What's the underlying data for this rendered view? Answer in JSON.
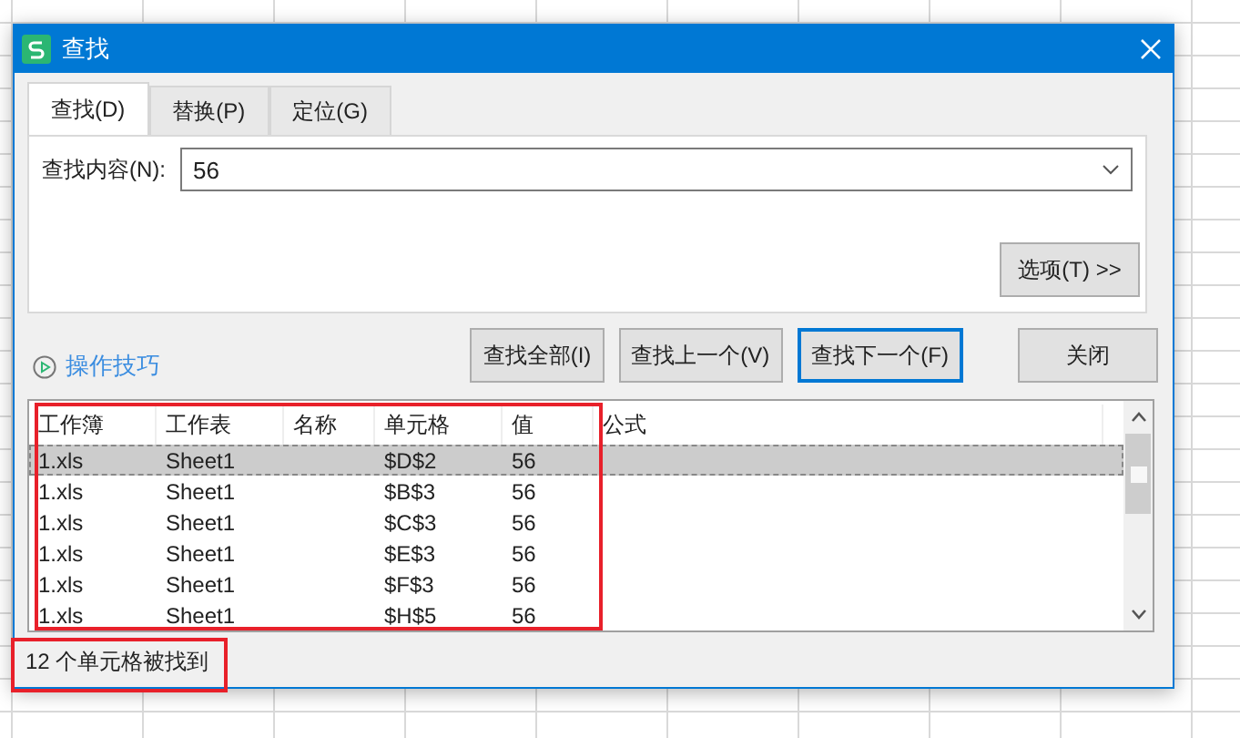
{
  "window": {
    "title": "查找"
  },
  "tabs": [
    {
      "label": "查找(D)",
      "selected": true
    },
    {
      "label": "替换(P)",
      "selected": false
    },
    {
      "label": "定位(G)",
      "selected": false
    }
  ],
  "find_field": {
    "label": "查找内容(N):",
    "value": "56"
  },
  "options_button": "选项(T) >>",
  "tips_link": "操作技巧",
  "buttons": [
    {
      "label": "查找全部(I)",
      "default": false
    },
    {
      "label": "查找上一个(V)",
      "default": false
    },
    {
      "label": "查找下一个(F)",
      "default": true
    }
  ],
  "close_button": "关闭",
  "results": {
    "highlighted": true,
    "columns": [
      "工作簿",
      "工作表",
      "名称",
      "单元格",
      "值",
      "公式"
    ],
    "rows": [
      {
        "workbook": "1.xls",
        "sheet": "Sheet1",
        "cell": "$D$2",
        "value": "56",
        "selected": true
      },
      {
        "workbook": "1.xls",
        "sheet": "Sheet1",
        "cell": "$B$3",
        "value": "56",
        "selected": false
      },
      {
        "workbook": "1.xls",
        "sheet": "Sheet1",
        "cell": "$C$3",
        "value": "56",
        "selected": false
      },
      {
        "workbook": "1.xls",
        "sheet": "Sheet1",
        "cell": "$E$3",
        "value": "56",
        "selected": false
      },
      {
        "workbook": "1.xls",
        "sheet": "Sheet1",
        "cell": "$F$3",
        "value": "56",
        "selected": false
      },
      {
        "workbook": "1.xls",
        "sheet": "Sheet1",
        "cell": "$H$5",
        "value": "56",
        "selected": false
      }
    ]
  },
  "status_bar": {
    "text": "12 个单元格被找到",
    "highlighted": true
  }
}
